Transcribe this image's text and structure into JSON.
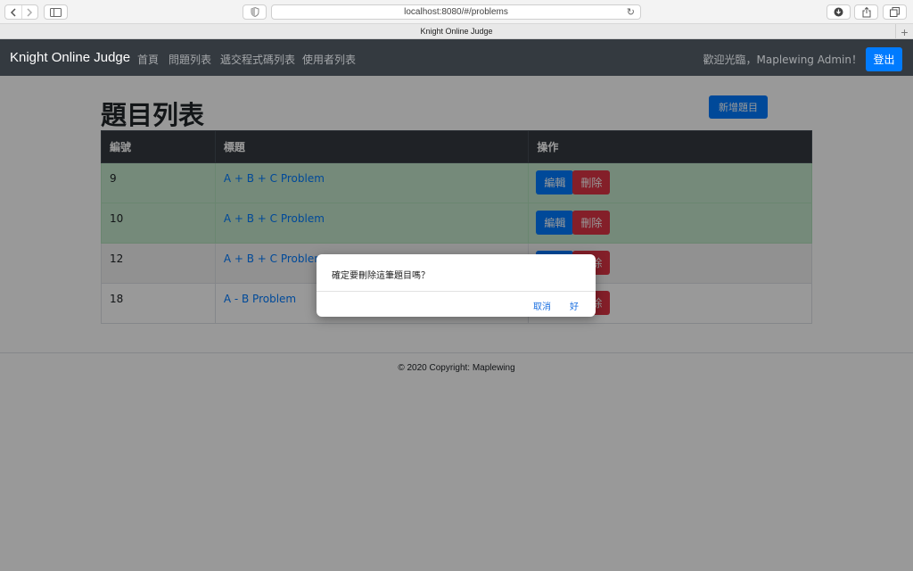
{
  "browser": {
    "url": "localhost:8080/#/problems",
    "tab_title": "Knight Online Judge",
    "icons": [
      "back-icon",
      "forward-icon",
      "sidebar-icon",
      "privacy-shield-icon",
      "reload-icon",
      "download-icon",
      "share-icon",
      "tabs-icon",
      "new-tab-plus-icon"
    ]
  },
  "navbar": {
    "brand": "Knight Online Judge",
    "links": [
      "首頁",
      "問題列表",
      "遞交程式碼列表",
      "使用者列表"
    ],
    "welcome": "歡迎光臨，Maplewing Admin！",
    "logout": "登出"
  },
  "page": {
    "title": "題目列表",
    "add_button": "新增題目"
  },
  "table": {
    "headers": [
      "編號",
      "標題",
      "操作"
    ],
    "rows": [
      {
        "id": "9",
        "title": "A + B + C Problem",
        "edit": "編輯",
        "delete": "刪除"
      },
      {
        "id": "10",
        "title": "A + B + C Problem",
        "edit": "編輯",
        "delete": "刪除"
      },
      {
        "id": "12",
        "title": "A + B + C Problem",
        "edit": "編輯",
        "delete": "刪除"
      },
      {
        "id": "18",
        "title": "A - B Problem",
        "edit": "編輯",
        "delete": "刪除"
      }
    ]
  },
  "footer": "© 2020 Copyright: Maplewing",
  "dialog": {
    "message": "確定要刪除這筆題目嗎？",
    "cancel": "取消",
    "ok": "好"
  },
  "colors": {
    "navbar": "#343a40",
    "primary": "#007bff",
    "danger": "#dc3545",
    "success_row": "#c3e6cb"
  }
}
